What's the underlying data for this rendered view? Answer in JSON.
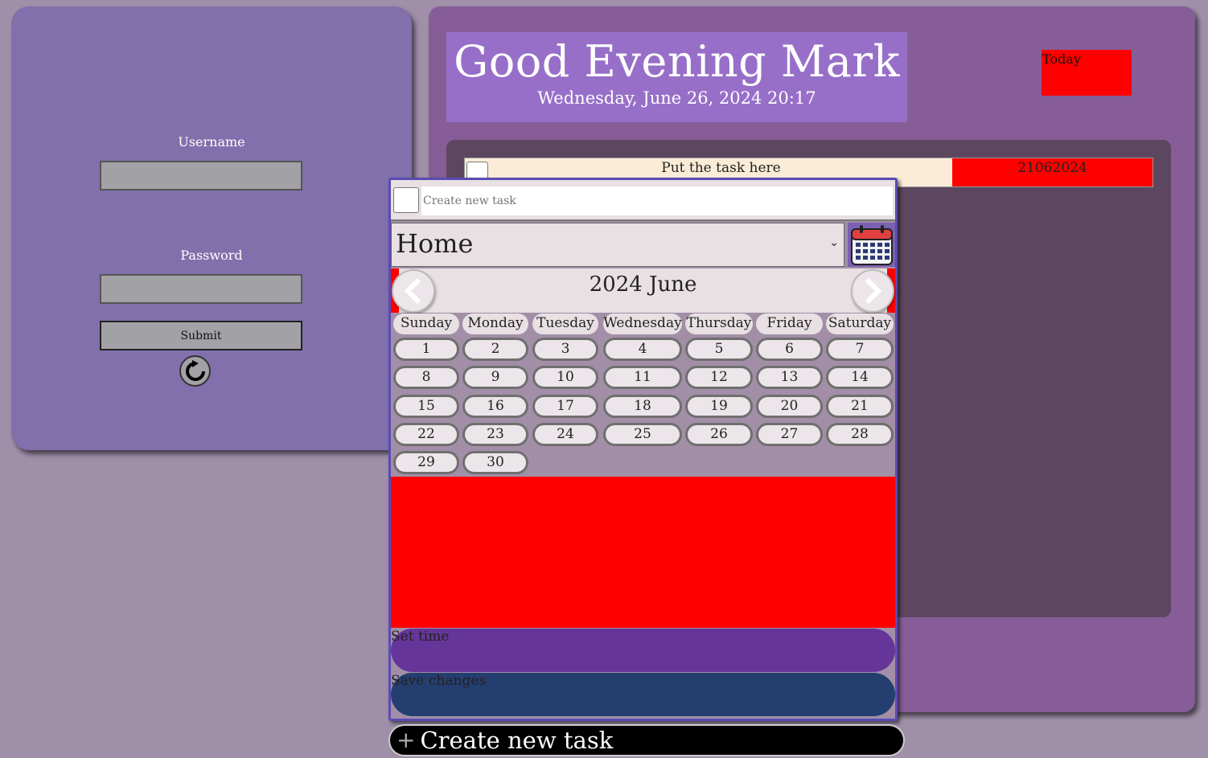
{
  "login": {
    "username_label": "Username",
    "username_value": "",
    "password_label": "Password",
    "password_value": "",
    "submit_label": "Submit"
  },
  "header": {
    "greeting": "Good Evening Mark",
    "datetime": "Wednesday, June 26, 2024 20:17",
    "today_label": "Today"
  },
  "tasks": [
    {
      "text": "Put the task here",
      "date": "21062024"
    }
  ],
  "editor": {
    "new_task_placeholder": "Create new task",
    "category_selected": "Home",
    "calendar": {
      "title": "2024 June",
      "weekdays": [
        "Sunday",
        "Monday",
        "Tuesday",
        "Wednesday",
        "Thursday",
        "Friday",
        "Saturday"
      ],
      "days": [
        "1",
        "2",
        "3",
        "4",
        "5",
        "6",
        "7",
        "8",
        "9",
        "10",
        "11",
        "12",
        "13",
        "14",
        "15",
        "16",
        "17",
        "18",
        "19",
        "20",
        "21",
        "22",
        "23",
        "24",
        "25",
        "26",
        "27",
        "28",
        "29",
        "30"
      ]
    },
    "set_time_label": "Set time",
    "save_changes_label": "Save changes"
  },
  "footer": {
    "create_task_label": "Create new task"
  },
  "colors": {
    "background": "#9f8fa8",
    "login_panel": "#8170ac",
    "main_panel": "#865d97",
    "greeting_box": "#976fc8",
    "tasks_area": "#5d4760",
    "highlight_red": "#ff0000",
    "set_time_pill": "#66359a",
    "save_pill": "#243e70"
  },
  "icons": {
    "refresh": "refresh-icon",
    "calendar": "calendar-icon",
    "prev": "chevron-left-icon",
    "next": "chevron-right-icon",
    "plus": "plus-icon"
  }
}
